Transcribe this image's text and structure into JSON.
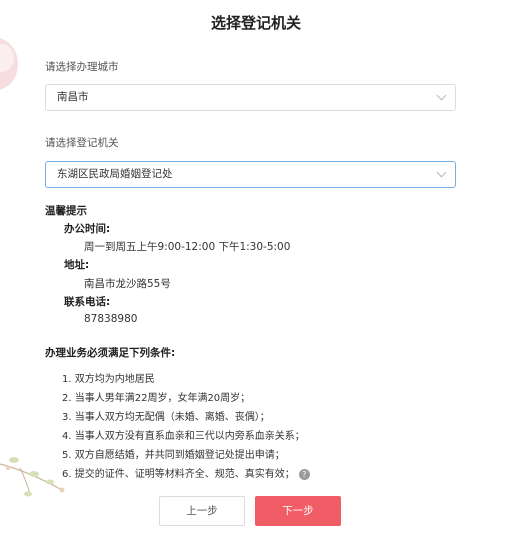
{
  "title": "选择登记机关",
  "city": {
    "label": "请选择办理城市",
    "value": "南昌市"
  },
  "office": {
    "label": "请选择登记机关",
    "value": "东湖区民政局婚姻登记处"
  },
  "tips": {
    "heading": "温馨提示",
    "hours_label": "办公时间:",
    "hours_value": "周一到周五上午9:00-12:00 下午1:30-5:00",
    "address_label": "地址:",
    "address_value": "南昌市龙沙路55号",
    "phone_label": "联系电话:",
    "phone_value": "87838980"
  },
  "conditions": {
    "title": "办理业务必须满足下列条件:",
    "items": [
      "1. 双方均为内地居民",
      "2. 当事人男年满22周岁，女年满20周岁；",
      "3. 当事人双方均无配偶（未婚、离婚、丧偶）；",
      "4. 当事人双方没有直系血亲和三代以内旁系血亲关系；",
      "5. 双方自愿结婚，并共同到婚姻登记处提出申请；",
      "6. 提交的证件、证明等材料齐全、规范、真实有效；"
    ],
    "help_icon_glyph": "?"
  },
  "buttons": {
    "prev": "上一步",
    "next": "下一步"
  },
  "colors": {
    "primary": "#f05d66",
    "focus_border": "#7aaee8"
  }
}
